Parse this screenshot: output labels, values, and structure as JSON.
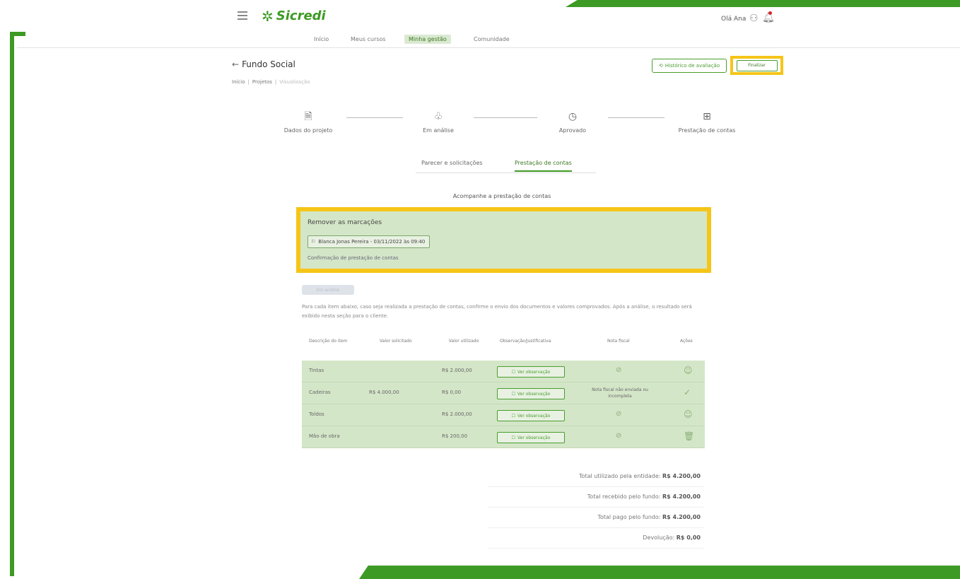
{
  "header": {
    "logo_text": "Sicredi",
    "user_name": "Olá Ana"
  },
  "nav": {
    "items": [
      {
        "label": "Início"
      },
      {
        "label": "Meus cursos"
      },
      {
        "label": "Minha gestão"
      },
      {
        "label": "Comunidade"
      }
    ]
  },
  "page": {
    "title": "Fundo Social",
    "breadcrumb": [
      "Início",
      "Projetos",
      "Visualização"
    ],
    "btn_history": "Histórico de avaliação",
    "btn_finalize": "Finalizar"
  },
  "stepper": {
    "steps": [
      {
        "icon": "document-icon",
        "label": "Dados do projeto"
      },
      {
        "icon": "tree-icon",
        "label": "Em análise"
      },
      {
        "icon": "clock-icon",
        "label": "Aprovado"
      },
      {
        "icon": "box-icon",
        "label": "Prestação de contas"
      }
    ]
  },
  "tabs": [
    {
      "label": "Parecer e solicitações"
    },
    {
      "label": "Prestação de contas"
    }
  ],
  "section_title": "Acompanhe a prestação de contas",
  "reminder": {
    "title": "Remover as marcações",
    "chip_text": "Blanca Jonas Pereira - 03/11/2022 às 09:40",
    "note": "Confirmação de prestação de contas"
  },
  "badge_text": "Em análise",
  "description": "Para cada item abaixo, caso seja realizada a prestação de contas, confirme o envio dos documentos e valores comprovados. Após a análise, o resultado será exibido nesta seção para o cliente.",
  "table": {
    "headers": [
      "Descrição do item",
      "Valor solicitado",
      "Valor utilizado",
      "Observação/Justificativa",
      "Nota fiscal",
      "Ações"
    ],
    "rows": [
      {
        "desc": "Tintas",
        "requested": "",
        "used": "R$ 2.000,00",
        "obs": "Ver observação",
        "invoice": "⊘"
      },
      {
        "desc": "Cadeiras",
        "requested": "R$ 4.000,00",
        "used": "R$ 0,00",
        "obs": "Ver observação",
        "invoice": "Nota fiscal não enviada ou incompleta"
      },
      {
        "desc": "Toldos",
        "requested": "",
        "used": "R$ 2.000,00",
        "obs": "Ver observação",
        "invoice": "⊘"
      },
      {
        "desc": "Mão de obra",
        "requested": "",
        "used": "R$ 200,00",
        "obs": "Ver observação",
        "invoice": "⊘"
      }
    ]
  },
  "totals": [
    {
      "label": "Total utilizado pela entidade:",
      "value": "R$ 4.200,00"
    },
    {
      "label": "Total recebido pelo fundo:",
      "value": "R$ 4.200,00"
    },
    {
      "label": "Total pago pelo fundo:",
      "value": "R$ 4.200,00"
    },
    {
      "label": "Devolução:",
      "value": "R$ 0,00"
    }
  ],
  "colors": {
    "brand_green": "#3d9a24",
    "highlight_yellow": "#f5c518",
    "panel_green": "#d4e6c8"
  }
}
